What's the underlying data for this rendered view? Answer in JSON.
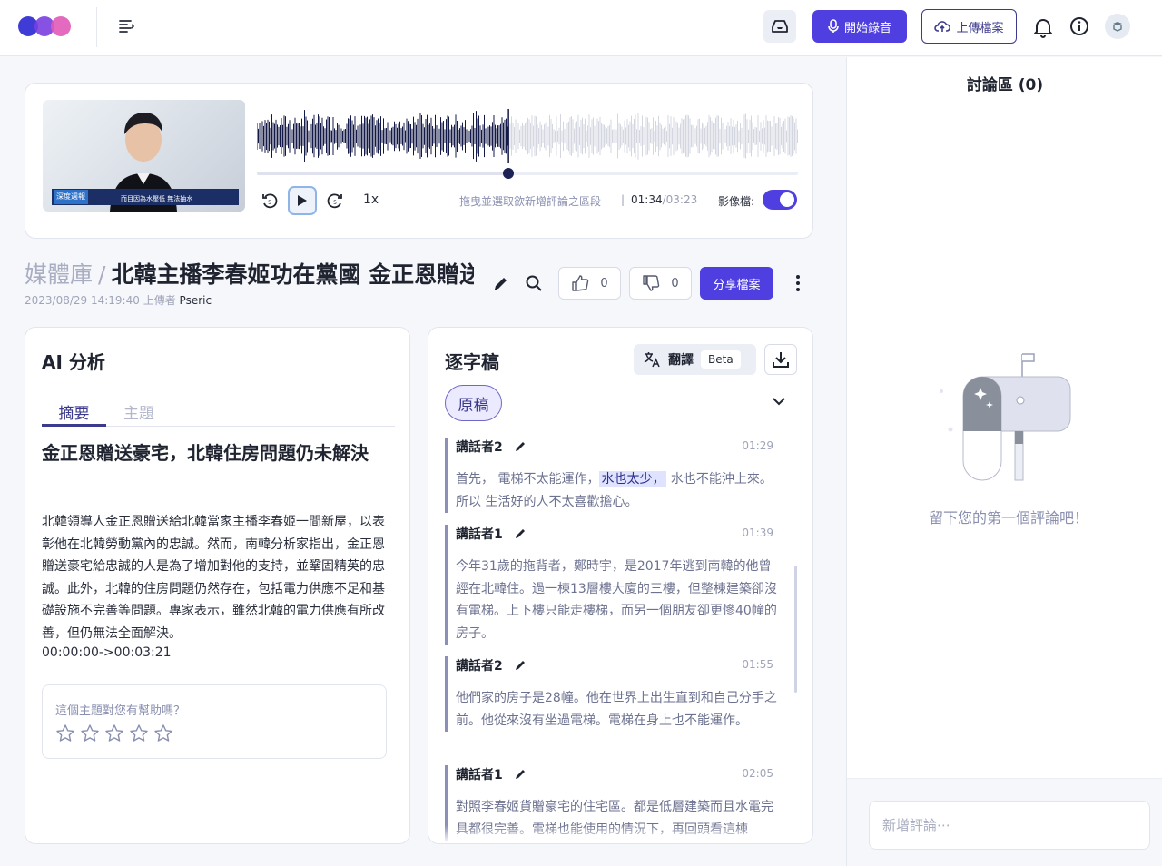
{
  "header": {
    "record_label": "開始錄音",
    "upload_label": "上傳檔案"
  },
  "player": {
    "video_caption_tag": "深度週報",
    "video_caption_text": "而目因為水壓低 無法抽水",
    "speed": "1x",
    "hint": "拖曳並選取欲新增評論之區段",
    "separator": "|",
    "current_time": "01:34",
    "time_sep": "/",
    "total_time": "03:23",
    "video_toggle_label": "影像檔:",
    "video_toggle_on": true,
    "progress_fraction": 0.465
  },
  "title": {
    "breadcrumb": "媒體庫",
    "breadcrumb_sep": "/",
    "doc_title": "北韓主播李春姬功在黨國 金正恩贈送豪宅",
    "date": "2023/08/29 14:19:40",
    "uploaded_by_label": "上傳者",
    "uploader": "Pseric",
    "likes": "0",
    "dislikes": "0",
    "share_label": "分享檔案"
  },
  "ai_panel": {
    "heading": "AI 分析",
    "tabs": [
      "摘要",
      "主題"
    ],
    "summary_title": "金正恩贈送豪宅，北韓住房問題仍未解決",
    "summary_body": "北韓領導人金正恩贈送給北韓當家主播李春姬一間新屋，以表彰他在北韓勞動黨內的忠誠。然而，南韓分析家指出，金正恩贈送豪宅給忠誠的人是為了增加對他的支持，並鞏固精英的忠誠。此外，北韓的住房問題仍然存在，包括電力供應不足和基礎設施不完善等問題。專家表示，雖然北韓的電力供應有所改善，但仍無法全面解決。",
    "summary_range": "00:00:00->00:03:21",
    "helpful_question": "這個主題對您有幫助嗎？",
    "rating": 0
  },
  "transcript": {
    "heading": "逐字稿",
    "translate_label": "翻譯",
    "beta_label": "Beta",
    "original_chip": "原稿",
    "segments": [
      {
        "speaker": "講話者2",
        "time": "01:29",
        "pre": "首先， 電梯不太能運作，",
        "highlight": "水也太少，",
        "post": " 水也不能沖上來。所以 生活好的人不太喜歡擔心。"
      },
      {
        "speaker": "講話者1",
        "time": "01:39",
        "pre": "今年31歲的拖背者，鄭時宇，是2017年逃到南韓的他曾經在北韓住。過一棟13層樓大廈的三樓，但整棟建築卻沒有電梯。上下樓只能走樓梯，而另一個朋友卻更慘40幢的房子。",
        "highlight": "",
        "post": ""
      },
      {
        "speaker": "講話者2",
        "time": "01:55",
        "pre": "他們家的房子是28幢。他在世界上出生直到和自己分手之前。他從來沒有坐過電梯。電梯在身上也不能運作。",
        "highlight": "",
        "post": ""
      },
      {
        "speaker": "講話者1",
        "time": "02:05",
        "pre": "對照李春姬貨贈豪宅的住宅區。都是低層建築而且水電完具都很完善。電梯也能使用的情況下，再回頭看這棟",
        "highlight": "",
        "post": ""
      }
    ]
  },
  "discussion": {
    "heading": "討論區 (0)",
    "empty_message": "留下您的第一個評論吧！",
    "comment_placeholder": "新增評論⋯"
  }
}
